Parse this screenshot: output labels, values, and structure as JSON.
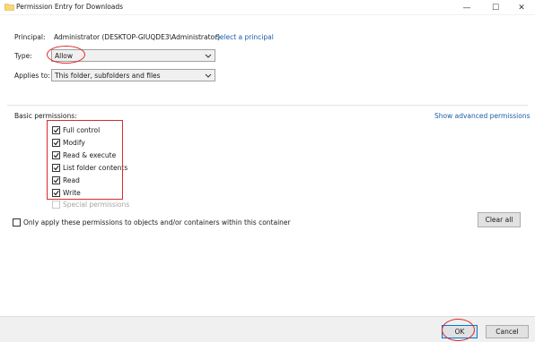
{
  "window": {
    "title": "Permission Entry for Downloads",
    "controls": {
      "minimize": "—",
      "maximize": "☐",
      "close": "✕"
    }
  },
  "principal": {
    "label": "Principal:",
    "value": "Administrator (DESKTOP-GIUQDE3\\Administrator)",
    "link": "Select a principal"
  },
  "type": {
    "label": "Type:",
    "value": "Allow"
  },
  "applies_to": {
    "label": "Applies to:",
    "value": "This folder, subfolders and files"
  },
  "basic_permissions": {
    "label": "Basic permissions:",
    "advanced_link": "Show advanced permissions",
    "items": [
      {
        "label": "Full control",
        "checked": true,
        "enabled": true
      },
      {
        "label": "Modify",
        "checked": true,
        "enabled": true
      },
      {
        "label": "Read & execute",
        "checked": true,
        "enabled": true
      },
      {
        "label": "List folder contents",
        "checked": true,
        "enabled": true
      },
      {
        "label": "Read",
        "checked": true,
        "enabled": true
      },
      {
        "label": "Write",
        "checked": true,
        "enabled": true
      },
      {
        "label": "Special permissions",
        "checked": false,
        "enabled": false
      }
    ]
  },
  "only_apply": {
    "label": "Only apply these permissions to objects and/or containers within this container",
    "checked": false
  },
  "buttons": {
    "clear_all": "Clear all",
    "ok": "OK",
    "cancel": "Cancel"
  },
  "colors": {
    "link": "#1a5ea8",
    "annotation": "#d92b2b",
    "footer_bg": "#f0f0f0",
    "ok_border": "#0078d7"
  }
}
